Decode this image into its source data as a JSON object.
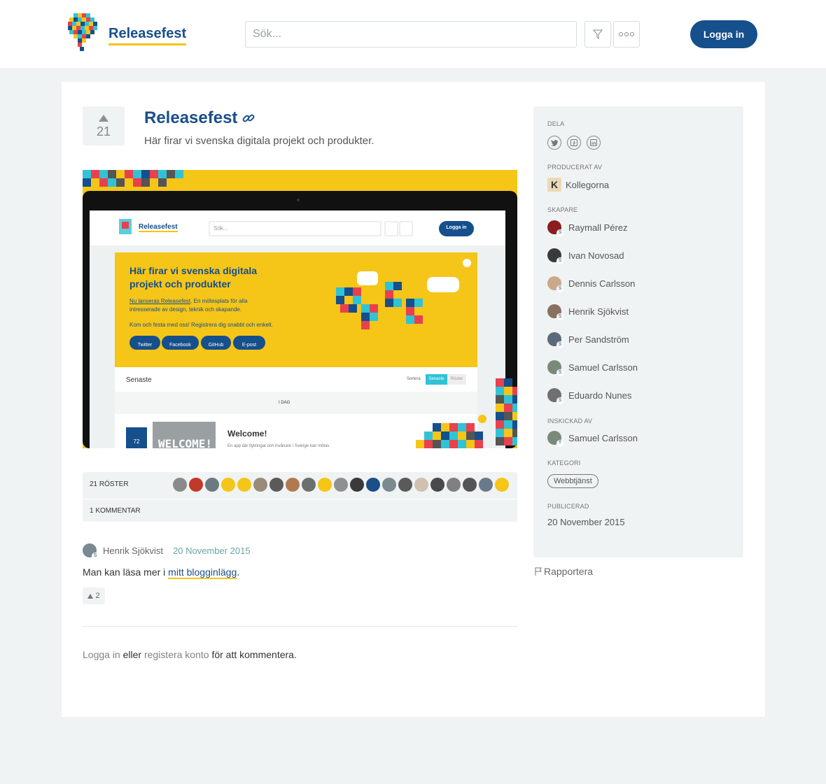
{
  "header": {
    "brand": "Releasefest",
    "search_placeholder": "Sök...",
    "login_label": "Logga in"
  },
  "product": {
    "votes": "21",
    "title": "Releasefest",
    "tagline": "Här firar vi svenska digitala projekt och produkter."
  },
  "screenshot": {
    "brand": "Releasefest",
    "search_placeholder": "Sök...",
    "login_label": "Logga in",
    "banner_title_1": "Här firar vi svenska digitala",
    "banner_title_2": "projekt och produkter",
    "banner_link": "Nu lanseras Releasefest",
    "banner_text_1": ". En mötesplats för alla",
    "banner_text_2": "intresserade av design, teknik och skapande.",
    "banner_text_3": "Kom och festa med oss! Registrera dig snabbt och enkelt.",
    "buttons": [
      "Twitter",
      "Facebook",
      "GitHub",
      "E-post"
    ],
    "list_title": "Senaste",
    "sort_label": "Sortera",
    "sort_active": "Senaste",
    "sort_other": "Röster",
    "day_label": "I DAG",
    "item_votes": "72",
    "item_title": "Welcome!",
    "item_image_text": "WELCOME!",
    "item_desc": "En app där flyktingar och invånare i Sverige kan mötas"
  },
  "votes_bar": {
    "label": "21 RÖSTER"
  },
  "comments_bar": {
    "label": "1 KOMMENTAR"
  },
  "comment": {
    "author": "Henrik Sjökvist",
    "badge": "S",
    "date": "20 November 2015",
    "text_before": "Man kan läsa mer i ",
    "link": "mitt blogginlägg",
    "text_after": ".",
    "votes": "2"
  },
  "cta": {
    "login": "Logga in",
    "or": " eller ",
    "register": "registera konto",
    "rest": " för att kommentera."
  },
  "sidebar": {
    "share_heading": "DELA",
    "producer_heading": "PRODUCERAT AV",
    "producer": "Kollegorna",
    "creators_heading": "SKAPARE",
    "creators": [
      {
        "name": "Raymall Pérez",
        "badge": "S"
      },
      {
        "name": "Ivan Novosad",
        "badge": "S"
      },
      {
        "name": "Dennis Carlsson",
        "badge": "S"
      },
      {
        "name": "Henrik Sjökvist",
        "badge": "S"
      },
      {
        "name": "Per Sandström",
        "badge": "S"
      },
      {
        "name": "Samuel Carlsson",
        "badge": "S"
      },
      {
        "name": "Eduardo Nunes",
        "badge": "S"
      }
    ],
    "submitted_heading": "INSKICKAD AV",
    "submitter": {
      "name": "Samuel Carlsson",
      "badge": "T"
    },
    "category_heading": "KATEGORI",
    "category": "Webbtjänst",
    "published_heading": "PUBLICERAD",
    "published": "20 November 2015"
  },
  "report_label": "Rapportera",
  "colors": {
    "brand_blue": "#154f8c",
    "accent_yellow": "#f5c518",
    "page_bg": "#f0f3f3",
    "date_teal": "#6aa5a5"
  },
  "icons": {
    "filter": "filter-icon",
    "more": "more-icon",
    "link": "link-icon",
    "twitter": "twitter-icon",
    "facebook": "facebook-icon",
    "linkedin": "linkedin-icon",
    "flag": "flag-icon"
  },
  "voter_avatar_colors": [
    "#8a8a8a",
    "#c0392b",
    "#6b7a80",
    "#f5c518",
    "#f5c518",
    "#9a8a7a",
    "#5a5a5a",
    "#b07a50",
    "#6a7070",
    "#f5c518",
    "#909090",
    "#3a3a3a",
    "#1a4f8a",
    "#7a8a90",
    "#5a5a5a",
    "#d0c0b0",
    "#4a4a4a",
    "#808080",
    "#555555",
    "#6a7a8a",
    "#f5c518"
  ]
}
